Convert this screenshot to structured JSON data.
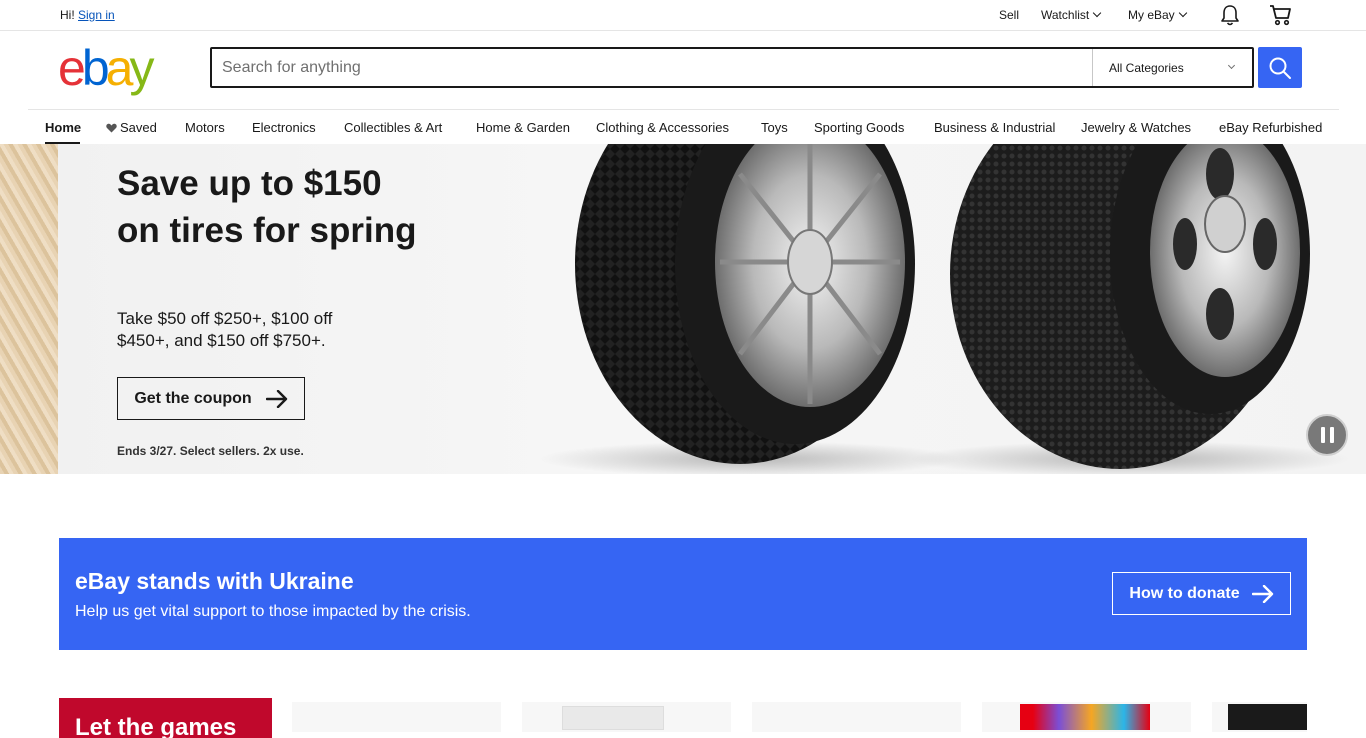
{
  "topbar": {
    "greeting": "Hi!",
    "signin": "Sign in",
    "sell": "Sell",
    "watchlist": "Watchlist",
    "myebay": "My eBay"
  },
  "logo": {
    "letters": [
      "e",
      "b",
      "a",
      "y"
    ],
    "colors": [
      "#e53238",
      "#0064d2",
      "#f5af02",
      "#86b817"
    ]
  },
  "search": {
    "placeholder": "Search for anything",
    "category": "All Categories",
    "button_icon": "search-icon"
  },
  "nav": {
    "items": [
      "Home",
      "Saved",
      "Motors",
      "Electronics",
      "Collectibles & Art",
      "Home & Garden",
      "Clothing & Accessories",
      "Toys",
      "Sporting Goods",
      "Business & Industrial",
      "Jewelry & Watches",
      "eBay Refurbished"
    ]
  },
  "hero": {
    "title": "Save up to $150 on tires for spring",
    "subtitle": "Take $50 off $250+, $100 off $450+, and $150 off $750+.",
    "cta": "Get the coupon",
    "fine_print": "Ends 3/27. Select sellers. 2x use."
  },
  "ukraine": {
    "title": "eBay stands with Ukraine",
    "subtitle": "Help us get vital support to those impacted by the crisis.",
    "button": "How to donate"
  },
  "promo": {
    "label": "Let the games"
  },
  "colors": {
    "accent": "#3665f3",
    "promo_red": "#c0082c"
  }
}
